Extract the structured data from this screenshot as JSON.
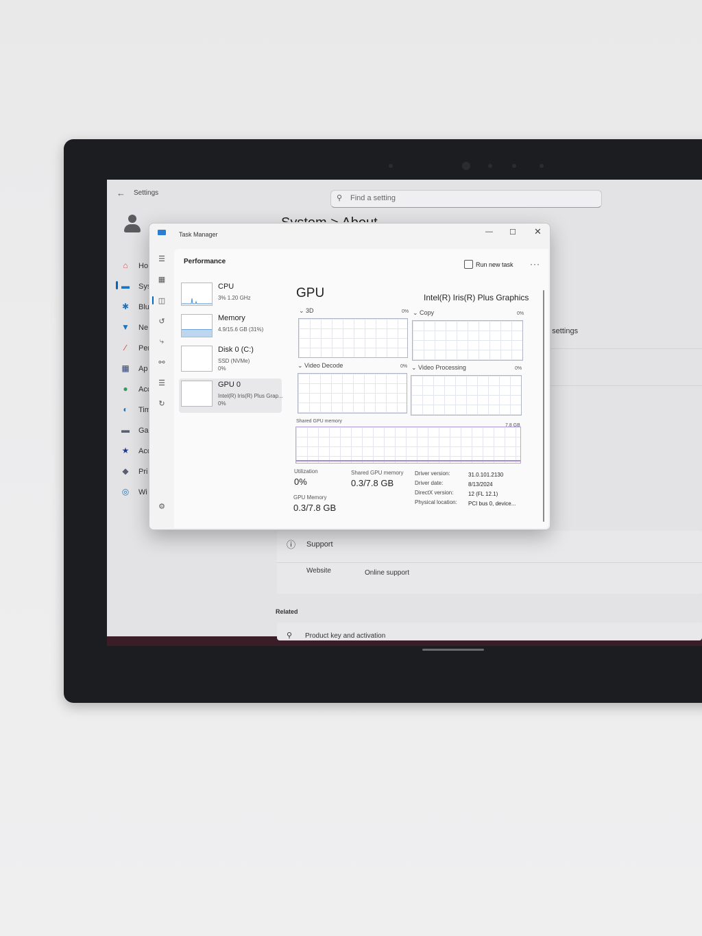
{
  "settings": {
    "back_icon": "arrow-left-icon",
    "title": "Settings",
    "search_placeholder": "Find a setting",
    "breadcrumb": "System  >  About",
    "nav": [
      {
        "label": "Ho",
        "icon": "home-icon",
        "color": "#d9534f"
      },
      {
        "label": "Sys",
        "icon": "system-icon",
        "color": "#1e73be"
      },
      {
        "label": "Blu",
        "icon": "bluetooth-icon",
        "color": "#1e73be"
      },
      {
        "label": "Ne",
        "icon": "wifi-icon",
        "color": "#1e73be"
      },
      {
        "label": "Per",
        "icon": "brush-icon",
        "color": "#c0392b"
      },
      {
        "label": "Ap",
        "icon": "apps-icon",
        "color": "#2c3e70"
      },
      {
        "label": "Acc",
        "icon": "accounts-icon",
        "color": "#2e9e5b"
      },
      {
        "label": "Tim",
        "icon": "time-language-icon",
        "color": "#1e73be"
      },
      {
        "label": "Ga",
        "icon": "gaming-icon",
        "color": "#5a6070"
      },
      {
        "label": "Acc",
        "icon": "accessibility-icon",
        "color": "#1e3c8c"
      },
      {
        "label": "Pri",
        "icon": "privacy-shield-icon",
        "color": "#5a6070"
      },
      {
        "label": "Wi",
        "icon": "windows-update-icon",
        "color": "#1e73be"
      }
    ],
    "right_settings_text": "n settings",
    "support_label": "Support",
    "website_label": "Website",
    "online_support": "Online support",
    "related_label": "Related",
    "product_key": "Product key and activation"
  },
  "taskmanager": {
    "title": "Task Manager",
    "section": "Performance",
    "run_new_task": "Run new task",
    "more": "···",
    "resources": [
      {
        "name": "CPU",
        "sub1": "3%  1.20 GHz",
        "sub2": ""
      },
      {
        "name": "Memory",
        "sub1": "4.9/15.6 GB (31%)",
        "sub2": ""
      },
      {
        "name": "Disk 0 (C:)",
        "sub1": "SSD (NVMe)",
        "sub2": "0%"
      },
      {
        "name": "GPU 0",
        "sub1": "Intel(R) Iris(R) Plus Grap...",
        "sub2": "0%"
      }
    ],
    "gpu": {
      "heading": "GPU",
      "model": "Intel(R) Iris(R) Plus Graphics",
      "engines": [
        {
          "label": "3D",
          "pct": "0%"
        },
        {
          "label": "Copy",
          "pct": "0%"
        },
        {
          "label": "Video Decode",
          "pct": "0%"
        },
        {
          "label": "Video Processing",
          "pct": "0%"
        }
      ],
      "shared_mem_label": "Shared GPU memory",
      "shared_mem_max": "7.8 GB",
      "utilization_label": "Utilization",
      "utilization_value": "0%",
      "shared_gpu_mem_label": "Shared GPU memory",
      "shared_gpu_mem_value": "0.3/7.8 GB",
      "gpu_memory_label": "GPU Memory",
      "gpu_memory_value": "0.3/7.8 GB",
      "info": [
        {
          "k": "Driver version:",
          "v": "31.0.101.2130"
        },
        {
          "k": "Driver date:",
          "v": "8/13/2024"
        },
        {
          "k": "DirectX version:",
          "v": "12 (FL 12.1)"
        },
        {
          "k": "Physical location:",
          "v": "PCI bus 0, device..."
        }
      ]
    }
  }
}
